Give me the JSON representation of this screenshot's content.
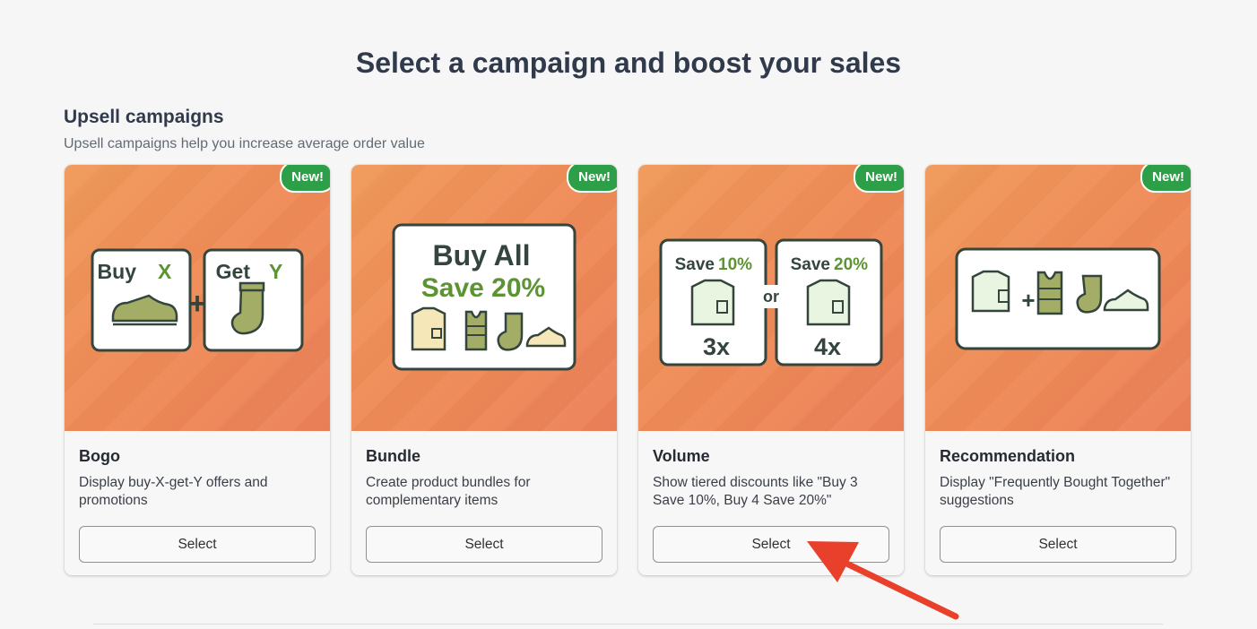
{
  "page": {
    "title": "Select a campaign and boost your sales"
  },
  "section": {
    "title": "Upsell campaigns",
    "subtitle": "Upsell campaigns help you increase average order value"
  },
  "cards": [
    {
      "badge": "New!",
      "title": "Bogo",
      "description": "Display buy-X-get-Y offers and promotions",
      "button": "Select",
      "illustration": {
        "left_label": "Buy",
        "left_var": "X",
        "right_label": "Get",
        "right_var": "Y",
        "joiner": "+"
      }
    },
    {
      "badge": "New!",
      "title": "Bundle",
      "description": "Create product bundles for complementary items",
      "button": "Select",
      "illustration": {
        "line1": "Buy All",
        "line2": "Save 20%"
      }
    },
    {
      "badge": "New!",
      "title": "Volume",
      "description": "Show tiered discounts like \"Buy 3 Save 10%, Buy 4 Save 20%\"",
      "button": "Select",
      "illustration": {
        "left_label": "Save",
        "left_pct": "10%",
        "left_qty": "3x",
        "joiner": "or",
        "right_label": "Save",
        "right_pct": "20%",
        "right_qty": "4x"
      }
    },
    {
      "badge": "New!",
      "title": "Recommendation",
      "description": "Display \"Frequently Bought Together\" suggestions",
      "button": "Select",
      "illustration": {
        "joiner": "+"
      }
    }
  ],
  "colors": {
    "card_bg_start": "#f09a5a",
    "card_bg_end": "#ec8058",
    "badge": "#2e9f49",
    "icon_green": "#a3ad66",
    "icon_dark": "#33453c",
    "accent_green": "#5c9434",
    "arrow": "#e8402a"
  }
}
